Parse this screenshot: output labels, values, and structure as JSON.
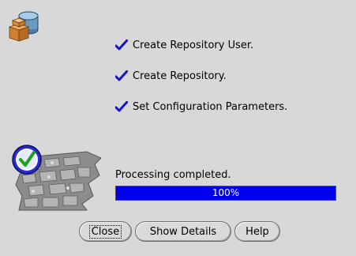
{
  "steps": [
    {
      "label": "Create Repository User.",
      "done": true
    },
    {
      "label": "Create Repository.",
      "done": true
    },
    {
      "label": "Set Configuration Parameters.",
      "done": true
    }
  ],
  "status": {
    "text": "Processing completed.",
    "progress_label": "100%",
    "progress_fraction": 1.0
  },
  "buttons": {
    "close": "Close",
    "details": "Show Details",
    "help": "Help"
  },
  "colors": {
    "background": "#d8d8d8",
    "progress": "#0000ee",
    "check": "#1414c8"
  },
  "icons": {
    "app": "repository-database-icon",
    "step_done": "checkmark-icon",
    "status": "success-check-icon"
  }
}
